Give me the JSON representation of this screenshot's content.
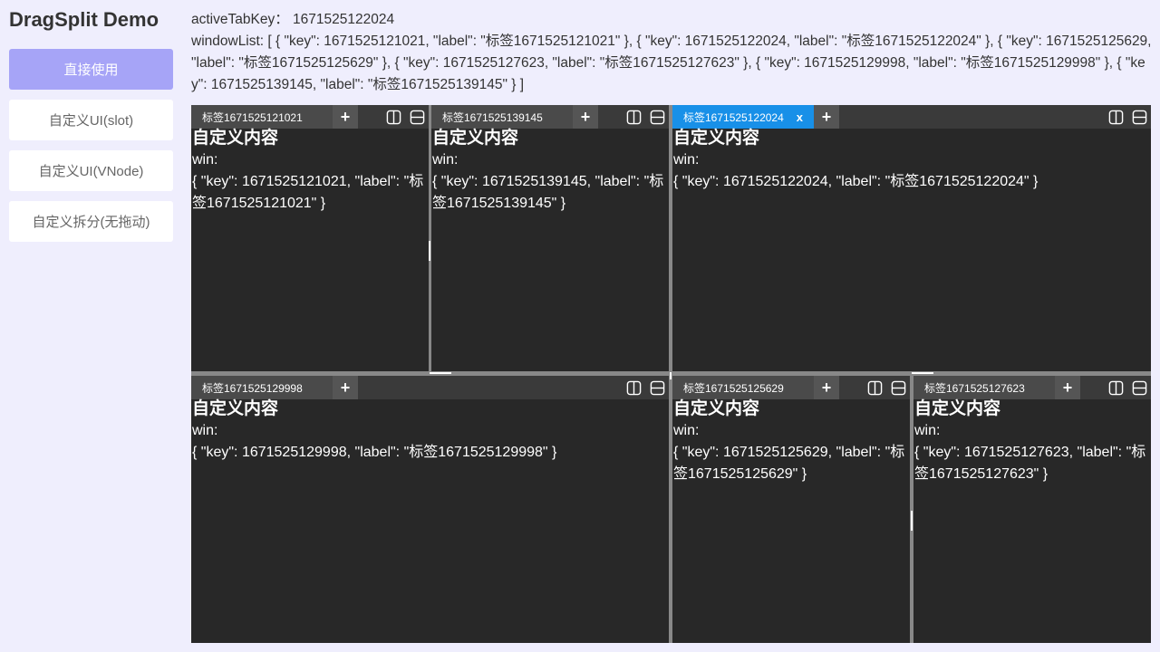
{
  "sidebar": {
    "title": "DragSplit Demo",
    "items": [
      {
        "label": "直接使用",
        "active": true
      },
      {
        "label": "自定义UI(slot)",
        "active": false
      },
      {
        "label": "自定义UI(VNode)",
        "active": false
      },
      {
        "label": "自定义拆分(无拖动)",
        "active": false
      }
    ]
  },
  "info": {
    "active_line": "activeTabKey：  1671525122024",
    "window_list_line": "windowList: [ { \"key\": 1671525121021, \"label\": \"标签1671525121021\" }, { \"key\": 1671525122024, \"label\": \"标签1671525122024\" }, { \"key\": 1671525125629, \"label\": \"标签1671525125629\" }, { \"key\": 1671525127623, \"label\": \"标签1671525127623\" }, { \"key\": 1671525129998, \"label\": \"标签1671525129998\" }, { \"key\": 1671525139145, \"label\": \"标签1671525139145\" } ]"
  },
  "panes": [
    {
      "tab": "标签1671525121021",
      "active": false,
      "heading": "自定义内容",
      "win_label": "win:",
      "win_json": "{ \"key\": 1671525121021, \"label\": \"标签1671525121021\" }"
    },
    {
      "tab": "标签1671525139145",
      "active": false,
      "heading": "自定义内容",
      "win_label": "win:",
      "win_json": "{ \"key\": 1671525139145, \"label\": \"标签1671525139145\" }"
    },
    {
      "tab": "标签1671525122024",
      "active": true,
      "close": "x",
      "heading": "自定义内容",
      "win_label": "win:",
      "win_json": "{ \"key\": 1671525122024, \"label\": \"标签1671525122024\" }"
    },
    {
      "tab": "标签1671525129998",
      "active": false,
      "heading": "自定义内容",
      "win_label": "win:",
      "win_json": "{ \"key\": 1671525129998, \"label\": \"标签1671525129998\" }"
    },
    {
      "tab": "标签1671525125629",
      "active": false,
      "heading": "自定义内容",
      "win_label": "win:",
      "win_json": "{ \"key\": 1671525125629, \"label\": \"标签1671525125629\" }"
    },
    {
      "tab": "标签1671525127623",
      "active": false,
      "heading": "自定义内容",
      "win_label": "win:",
      "win_json": "{ \"key\": 1671525127623, \"label\": \"标签1671525127623\" }"
    }
  ],
  "controls": {
    "add_label": "+"
  },
  "colors": {
    "active_tab": "#1890e8",
    "active_menu": "#a6a4f7",
    "pane_bg": "#282828"
  },
  "icons": {
    "split_vertical": "split-vertical-icon",
    "split_horizontal": "split-horizontal-icon"
  }
}
